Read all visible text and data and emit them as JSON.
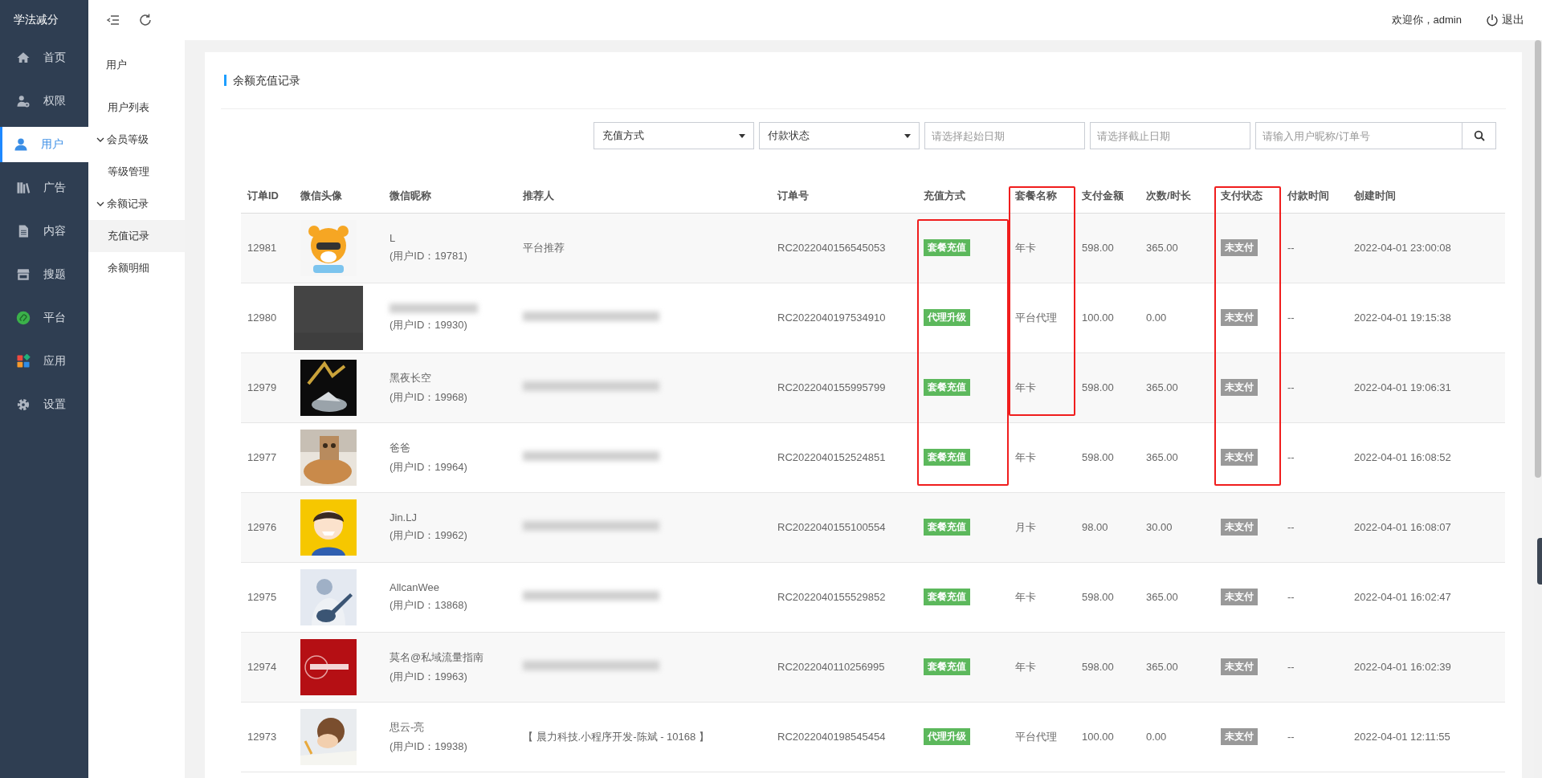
{
  "brand": "学法减分",
  "nav": [
    {
      "label": "首页",
      "selected": false
    },
    {
      "label": "权限",
      "selected": false
    },
    {
      "label": "用户",
      "selected": true
    },
    {
      "label": "广告",
      "selected": false
    },
    {
      "label": "内容",
      "selected": false
    },
    {
      "label": "搜题",
      "selected": false
    },
    {
      "label": "平台",
      "selected": false
    },
    {
      "label": "应用",
      "selected": false
    },
    {
      "label": "设置",
      "selected": false
    }
  ],
  "submenu": {
    "title": "用户",
    "items": [
      {
        "kind": "item",
        "label": "用户列表",
        "selected": false
      },
      {
        "kind": "group",
        "label": "会员等级",
        "expanded": true,
        "children": [
          {
            "kind": "item",
            "label": "等级管理",
            "selected": false
          }
        ]
      },
      {
        "kind": "group",
        "label": "余额记录",
        "expanded": true,
        "children": [
          {
            "kind": "item",
            "label": "充值记录",
            "selected": true
          },
          {
            "kind": "item",
            "label": "余额明细",
            "selected": false
          }
        ]
      }
    ]
  },
  "topbar": {
    "welcome": "欢迎你，admin",
    "logout": "退出"
  },
  "card": {
    "title": "余额充值记录"
  },
  "filters": {
    "selects": [
      "充值方式",
      "付款状态"
    ],
    "start_date": {
      "placeholder": "请选择起始日期"
    },
    "end_date": {
      "placeholder": "请选择截止日期"
    },
    "search": {
      "placeholder": "请输入用户昵称/订单号"
    }
  },
  "table": {
    "columns": [
      {
        "label": "订单ID",
        "marked": false
      },
      {
        "label": "微信头像",
        "marked": false
      },
      {
        "label": "微信昵称",
        "marked": false
      },
      {
        "label": "推荐人",
        "marked": false
      },
      {
        "label": "订单号",
        "marked": false
      },
      {
        "label": "充值方式",
        "marked": false
      },
      {
        "label": "套餐名称",
        "marked": true
      },
      {
        "label": "支付金额",
        "marked": false
      },
      {
        "label": "次数/时长",
        "marked": false
      },
      {
        "label": "支付状态",
        "marked": true
      },
      {
        "label": "付款时间",
        "marked": false
      },
      {
        "label": "创建时间",
        "marked": false
      }
    ],
    "rows": [
      {
        "id": "12981",
        "nickname": {
          "kind": "text",
          "text": "L"
        },
        "user_id": "(用户ID：19781)",
        "referrer": {
          "kind": "text",
          "text": "平台推荐"
        },
        "order_no": "RC2022040156545053",
        "method": "套餐充值",
        "package": "年卡",
        "amount": "598.00",
        "count": "365.00",
        "status": "未支付",
        "paid_at": "--",
        "created_at": "2022-04-01 23:00:08",
        "method_marked": true,
        "package_marked": true,
        "status_marked": true
      },
      {
        "id": "12980",
        "nickname": {
          "kind": "redacted"
        },
        "user_id": "(用户ID：19930)",
        "referrer": {
          "kind": "redacted"
        },
        "order_no": "RC2022040197534910",
        "method": "代理升级",
        "package": "平台代理",
        "amount": "100.00",
        "count": "0.00",
        "status": "未支付",
        "paid_at": "--",
        "created_at": "2022-04-01 19:15:38",
        "method_marked": true,
        "package_marked": true,
        "status_marked": true
      },
      {
        "id": "12979",
        "nickname": {
          "kind": "text",
          "text": "黑夜长空"
        },
        "user_id": "(用户ID：19968)",
        "referrer": {
          "kind": "redacted"
        },
        "order_no": "RC2022040155995799",
        "method": "套餐充值",
        "package": "年卡",
        "amount": "598.00",
        "count": "365.00",
        "status": "未支付",
        "paid_at": "--",
        "created_at": "2022-04-01 19:06:31",
        "method_marked": true,
        "package_marked": true,
        "status_marked": true
      },
      {
        "id": "12977",
        "nickname": {
          "kind": "text",
          "text": "爸爸"
        },
        "user_id": "(用户ID：19964)",
        "referrer": {
          "kind": "redacted"
        },
        "order_no": "RC2022040152524851",
        "method": "套餐充值",
        "package": "年卡",
        "amount": "598.00",
        "count": "365.00",
        "status": "未支付",
        "paid_at": "--",
        "created_at": "2022-04-01 16:08:52",
        "method_marked": true,
        "package_marked": false,
        "status_marked": true
      },
      {
        "id": "12976",
        "nickname": {
          "kind": "text",
          "text": "Jin.LJ"
        },
        "user_id": "(用户ID：19962)",
        "referrer": {
          "kind": "redacted"
        },
        "order_no": "RC2022040155100554",
        "method": "套餐充值",
        "package": "月卡",
        "amount": "98.00",
        "count": "30.00",
        "status": "未支付",
        "paid_at": "--",
        "created_at": "2022-04-01 16:08:07",
        "method_marked": false,
        "package_marked": false,
        "status_marked": false
      },
      {
        "id": "12975",
        "nickname": {
          "kind": "text",
          "text": "AllcanWee"
        },
        "user_id": "(用户ID：13868)",
        "referrer": {
          "kind": "redacted"
        },
        "order_no": "RC2022040155529852",
        "method": "套餐充值",
        "package": "年卡",
        "amount": "598.00",
        "count": "365.00",
        "status": "未支付",
        "paid_at": "--",
        "created_at": "2022-04-01 16:02:47",
        "method_marked": false,
        "package_marked": false,
        "status_marked": false
      },
      {
        "id": "12974",
        "nickname": {
          "kind": "text",
          "text": "莫名@私域流量指南"
        },
        "user_id": "(用户ID：19963)",
        "referrer": {
          "kind": "redacted"
        },
        "order_no": "RC2022040110256995",
        "method": "套餐充值",
        "package": "年卡",
        "amount": "598.00",
        "count": "365.00",
        "status": "未支付",
        "paid_at": "--",
        "created_at": "2022-04-01 16:02:39",
        "method_marked": false,
        "package_marked": false,
        "status_marked": false
      },
      {
        "id": "12973",
        "nickname": {
          "kind": "text",
          "text": "思云-亮"
        },
        "user_id": "(用户ID：19938)",
        "referrer": {
          "kind": "text",
          "text": "【 晨力科技.小程序开发-陈斌 - 10168 】"
        },
        "order_no": "RC2022040198545454",
        "method": "代理升级",
        "package": "平台代理",
        "amount": "100.00",
        "count": "0.00",
        "status": "未支付",
        "paid_at": "--",
        "created_at": "2022-04-01 12:11:55",
        "method_marked": false,
        "package_marked": false,
        "status_marked": false
      }
    ]
  }
}
